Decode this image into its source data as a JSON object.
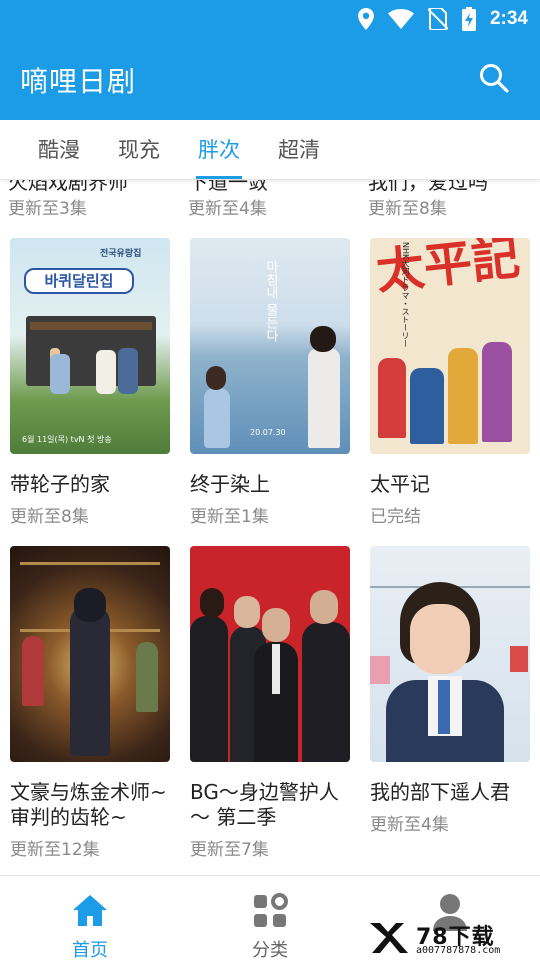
{
  "status_bar": {
    "time": "2:34"
  },
  "app_bar": {
    "title": "嘀哩日剧"
  },
  "tabs": [
    {
      "label": "酷漫",
      "active": false
    },
    {
      "label": "现充",
      "active": false
    },
    {
      "label": "胖次",
      "active": true
    },
    {
      "label": "超清",
      "active": false
    }
  ],
  "clipped_row": [
    {
      "title": "火焰戏剧界师",
      "subtitle": "更新至3集"
    },
    {
      "title": "下道一敛",
      "subtitle": "更新至4集"
    },
    {
      "title": "我们，爱过吗",
      "subtitle": "更新至8集"
    }
  ],
  "cards": [
    {
      "title": "带轮子的家",
      "subtitle": "更新至8集"
    },
    {
      "title": "终于染上",
      "subtitle": "更新至1集"
    },
    {
      "title": "太平记",
      "subtitle": "已完结"
    },
    {
      "title": "文豪与炼金术师~审判的齿轮~",
      "subtitle": "更新至12集"
    },
    {
      "title": "BG～身边警护人～ 第二季",
      "subtitle": "更新至7集"
    },
    {
      "title": "我的部下遥人君",
      "subtitle": "更新至4集"
    }
  ],
  "posters": {
    "p1": {
      "top_text": "전국유랑집",
      "title_text": "바퀴달린집",
      "bottom_text": "6월 11일(목) tvN 첫 방송"
    },
    "p2": {
      "vertical_text": "마침내 물든다",
      "date_text": "20.07.30"
    },
    "p3": {
      "big_text": "太平記",
      "side_text": "NHK大河ドラマ・ストーリー"
    }
  },
  "bottom_nav": [
    {
      "label": "首页",
      "icon": "home-icon",
      "active": true
    },
    {
      "label": "分类",
      "icon": "grid-icon",
      "active": false
    },
    {
      "label": "",
      "icon": "profile-icon",
      "active": false
    }
  ],
  "watermark": {
    "text": "78下载",
    "url": "a007787878.com"
  },
  "colors": {
    "primary": "#1c9be6",
    "text": "#222222",
    "subtext": "#8a8a8a"
  }
}
